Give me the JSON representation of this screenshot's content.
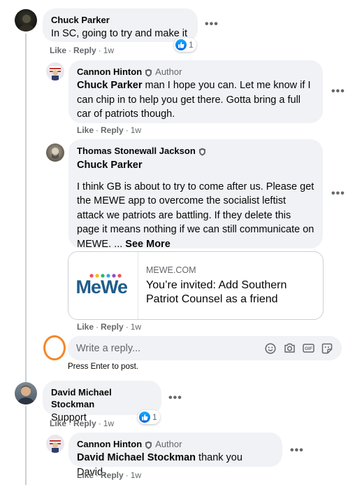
{
  "actions": {
    "like": "Like",
    "reply": "Reply",
    "sep": "·"
  },
  "comments": {
    "c1": {
      "author": "Chuck Parker",
      "text": "In SC, going to try and make it",
      "time": "1w",
      "reactions": "1"
    },
    "r1": {
      "author": "Cannon Hinton",
      "badge": "Author",
      "mention": "Chuck Parker",
      "text": " man I hope you can. Let me know if I can chip in to help you get there. Gotta bring a full car of patriots though.",
      "time": "1w"
    },
    "r2": {
      "author": "Thomas Stonewall Jackson",
      "mention": "Chuck Parker",
      "text": "I think GB is about to try to come after us. Please get the MEWE app to overcome the socialist leftist attack we patriots are battling. If they delete this page it means nothing if we can still communicate on MEWE. ...",
      "see_more": "See More",
      "time": "1w",
      "link": {
        "logo": "MeWe",
        "domain": "MEWE.COM",
        "title": "You’re invited: Add Southern Patriot Counsel as a friend"
      }
    },
    "c2": {
      "author": "David Michael Stockman",
      "text": "Support",
      "time": "1w",
      "reactions": "1"
    },
    "r3": {
      "author": "Cannon Hinton",
      "badge": "Author",
      "mention": "David Michael Stockman",
      "text": " thank you David.",
      "time": "1w"
    }
  },
  "reply_box": {
    "placeholder": "Write a reply...",
    "hint": "Press Enter to post."
  },
  "colors": {
    "link": "#1877f2",
    "secondary": "#65676b",
    "bubble": "#f0f2f5",
    "annotation": "#f5862a"
  }
}
